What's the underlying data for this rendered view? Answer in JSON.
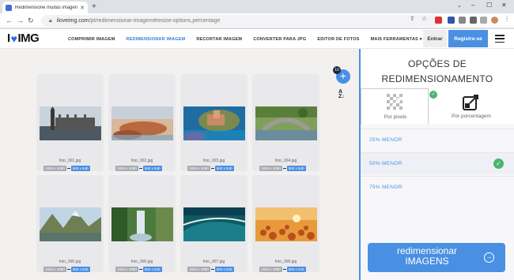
{
  "browser": {
    "tab_title": "Redimensione muitas imagens o...",
    "url_domain": "iloveimg.com",
    "url_path": "/pt/redimensionar-imagem#resize-options,percentage"
  },
  "site": {
    "logo_left": "I",
    "logo_right": "IMG",
    "nav": [
      "COMPRIMIR IMAGEM",
      "REDIMENSIONAR IMAGEM",
      "RECORTAR IMAGEM",
      "CONVERTER PARA JPG",
      "EDITOR DE FOTOS",
      "MAIS FERRAMENTAS ▾"
    ],
    "active_nav_index": 1,
    "login": "Entrar",
    "register": "Registre-se"
  },
  "files": [
    {
      "name": "foto_001.jpg",
      "old": "1920 x 1080",
      "new": "960 x 540"
    },
    {
      "name": "foto_002.jpg",
      "old": "1920 x 1080",
      "new": "960 x 540"
    },
    {
      "name": "foto_003.jpg",
      "old": "1920 x 1080",
      "new": "960 x 540"
    },
    {
      "name": "foto_004.jpg",
      "old": "1920 x 1080",
      "new": "960 x 540"
    },
    {
      "name": "foto_005.jpg",
      "old": "1920 x 1080",
      "new": "960 x 540"
    },
    {
      "name": "foto_006.jpg",
      "old": "1920 x 1080",
      "new": "960 x 540"
    },
    {
      "name": "foto_007.jpg",
      "old": "1920 x 1080",
      "new": "960 x 540"
    },
    {
      "name": "foto_008.jpg",
      "old": "1920 x 1080",
      "new": "960 x 540"
    }
  ],
  "file_count": "10",
  "panel": {
    "title_line1": "OPÇÕES DE",
    "title_line2": "REDIMENSIONAMENTO",
    "mode_pixels": "Por pixels",
    "mode_percent": "Por porcentagem",
    "options": [
      "25% MENOR",
      "50% MENOR",
      "75% MENOR"
    ],
    "selected_option_index": 1,
    "cta_line1": "redimensionar",
    "cta_line2": "IMAGENS"
  },
  "colors": {
    "accent": "#4a90e2",
    "check": "#4bb46e"
  }
}
